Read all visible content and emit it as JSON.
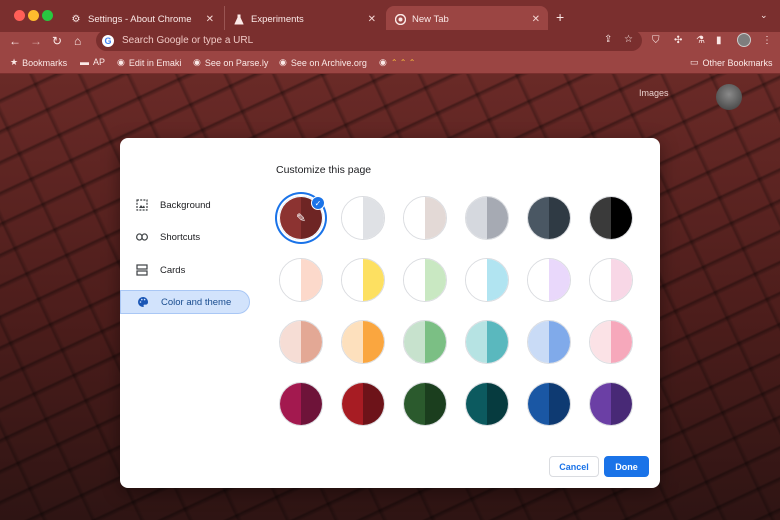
{
  "tabs": [
    {
      "title": "Settings - About Chrome",
      "icon": "gear-icon"
    },
    {
      "title": "Experiments",
      "icon": "flask-icon"
    },
    {
      "title": "New Tab",
      "icon": "chrome-icon"
    }
  ],
  "omnibox": {
    "placeholder": "Search Google or type a URL"
  },
  "bookmarks": [
    {
      "label": "Bookmarks",
      "icon": "star-icon"
    },
    {
      "label": "AP",
      "icon": "folder-icon"
    },
    {
      "label": "Edit in Emaki",
      "icon": "globe-icon"
    },
    {
      "label": "See on Parse.ly",
      "icon": "globe-icon"
    },
    {
      "label": "See on Archive.org",
      "icon": "globe-icon"
    },
    {
      "label": "",
      "icon": "globe-icon"
    }
  ],
  "bookmarks_other": "Other Bookmarks",
  "ntp": {
    "images_link": "Images"
  },
  "dialog": {
    "title": "Customize this page",
    "menu": [
      {
        "label": "Background",
        "icon": "image-icon",
        "active": false
      },
      {
        "label": "Shortcuts",
        "icon": "link-icon",
        "active": false
      },
      {
        "label": "Cards",
        "icon": "cards-icon",
        "active": false
      },
      {
        "label": "Color and theme",
        "icon": "palette-icon",
        "active": true
      }
    ],
    "swatches": [
      [
        "#8c3331",
        "#6e2524",
        true
      ],
      [
        "#ffffff",
        "#dfe1e5",
        false
      ],
      [
        "#ffffff",
        "#e3d9d6",
        false
      ],
      [
        "#d5d8de",
        "#a6aab3",
        false
      ],
      [
        "#4a5763",
        "#2f3a44",
        false
      ],
      [
        "#3a3a3a",
        "#000000",
        false
      ],
      [
        "#ffffff",
        "#fcd9cb",
        false
      ],
      [
        "#ffffff",
        "#fde061",
        false
      ],
      [
        "#ffffff",
        "#c9e8c2",
        false
      ],
      [
        "#ffffff",
        "#b1e4f1",
        false
      ],
      [
        "#ffffff",
        "#e9d8fb",
        false
      ],
      [
        "#ffffff",
        "#f8d7e6",
        false
      ],
      [
        "#f6ddd5",
        "#e3a895",
        false
      ],
      [
        "#fde0bd",
        "#faa63f",
        false
      ],
      [
        "#c7e2cd",
        "#7bbf84",
        false
      ],
      [
        "#b6e3e3",
        "#5ab8be",
        false
      ],
      [
        "#c9dbf6",
        "#80aaea",
        false
      ],
      [
        "#fbe2e6",
        "#f6a8bb",
        false
      ],
      [
        "#a3194f",
        "#6e1339",
        false
      ],
      [
        "#a71c23",
        "#6d1319",
        false
      ],
      [
        "#2b5a2d",
        "#1b3e1e",
        false
      ],
      [
        "#0c5a5f",
        "#063b3f",
        false
      ],
      [
        "#1a57a4",
        "#0e3a72",
        false
      ],
      [
        "#6b3fa5",
        "#482976",
        false
      ]
    ],
    "cancel_label": "Cancel",
    "done_label": "Done"
  }
}
